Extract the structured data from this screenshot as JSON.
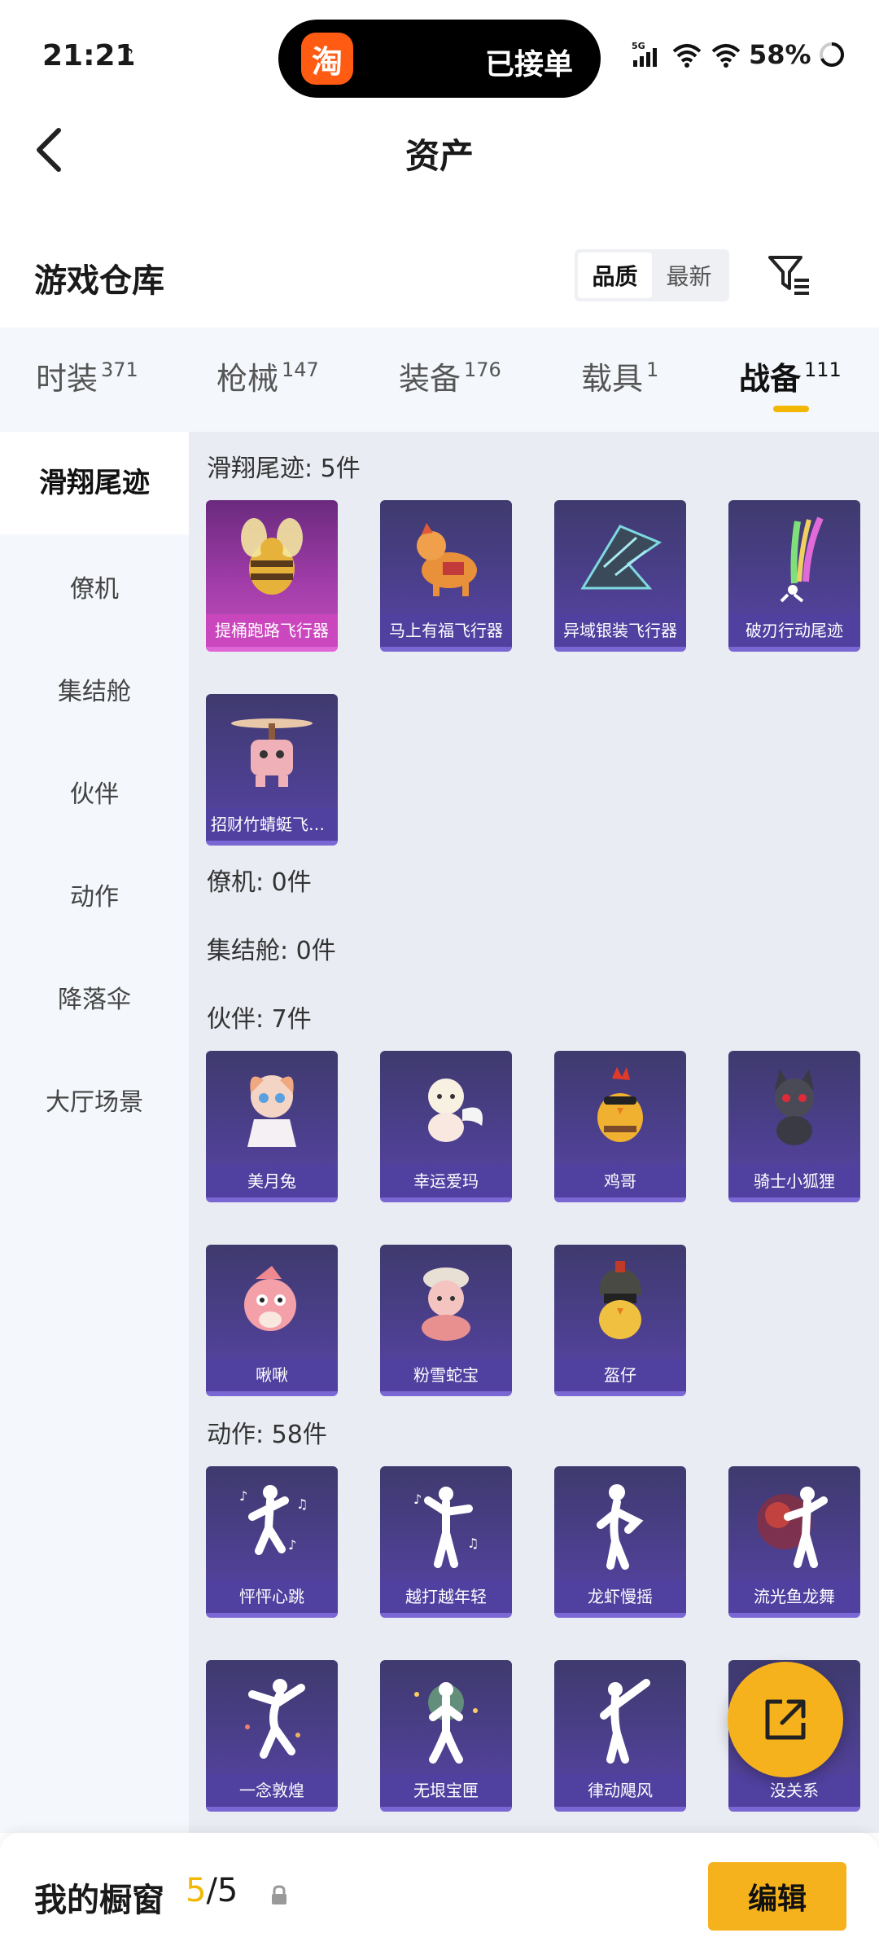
{
  "status_bar": {
    "time": "21:21",
    "island_app": "淘",
    "island_text": "已接单",
    "network": "5G",
    "battery": "58%"
  },
  "header": {
    "title": "资产"
  },
  "warehouse": {
    "title": "游戏仓库",
    "sort_options": [
      "品质",
      "最新"
    ],
    "active_sort": "品质"
  },
  "categories": [
    {
      "label": "时装",
      "count": "371"
    },
    {
      "label": "枪械",
      "count": "147"
    },
    {
      "label": "装备",
      "count": "176"
    },
    {
      "label": "载具",
      "count": "1"
    },
    {
      "label": "战备",
      "count": "111"
    }
  ],
  "active_category": "战备",
  "sidebar": {
    "items": [
      "滑翔尾迹",
      "僚机",
      "集结舱",
      "伙伴",
      "动作",
      "降落伞",
      "大厅场景"
    ],
    "active": "滑翔尾迹"
  },
  "sections": {
    "glide": {
      "title": "滑翔尾迹: 5件",
      "items": [
        "提桶跑路飞行器",
        "马上有福飞行器",
        "异域银装飞行器",
        "破刃行动尾迹",
        "招财竹蜻蜓飞行器"
      ]
    },
    "wingman": {
      "title": "僚机: 0件"
    },
    "pod": {
      "title": "集结舱: 0件"
    },
    "partner": {
      "title": "伙伴: 7件",
      "items": [
        "美月兔",
        "幸运爱玛",
        "鸡哥",
        "骑士小狐狸",
        "啾啾",
        "粉雪蛇宝",
        "盔仔"
      ]
    },
    "action": {
      "title": "动作: 58件",
      "items": [
        "怦怦心跳",
        "越打越年轻",
        "龙虾慢摇",
        "流光鱼龙舞",
        "一念敦煌",
        "无垠宝匣",
        "律动飓风",
        "没关系"
      ]
    }
  },
  "bottom_bar": {
    "title": "我的橱窗",
    "count_current": "5",
    "count_total": "/5",
    "edit_label": "编辑"
  },
  "colors": {
    "accent": "#f6b21c",
    "tab_underline": "#f2b705",
    "card_purple": "#4b3f8c",
    "card_pink": "#c24fba"
  },
  "icons": [
    "back-arrow-icon",
    "filter-icon",
    "lock-icon",
    "share-icon",
    "signal-icon",
    "wifi-icon",
    "tiktok-icon"
  ]
}
